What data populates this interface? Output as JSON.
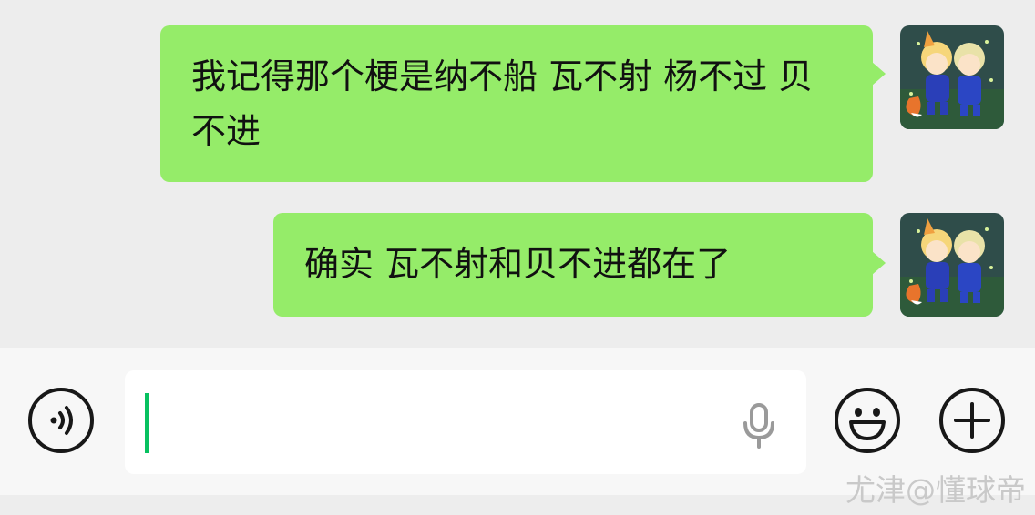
{
  "messages": [
    {
      "sender": "self",
      "text": "我记得那个梗是纳不船 瓦不射 杨不过 贝不进"
    },
    {
      "sender": "self",
      "text": "确实 瓦不射和贝不进都在了"
    }
  ],
  "input_bar": {
    "text_value": "",
    "voice_icon": "voice-mode-icon",
    "mic_icon": "microphone-icon",
    "emoji_icon": "emoji-face-icon",
    "plus_icon": "plus-icon"
  },
  "watermark": "尤津@懂球帝",
  "colors": {
    "bubble_self": "#95ec69",
    "background": "#ededed",
    "caret": "#07c160"
  }
}
